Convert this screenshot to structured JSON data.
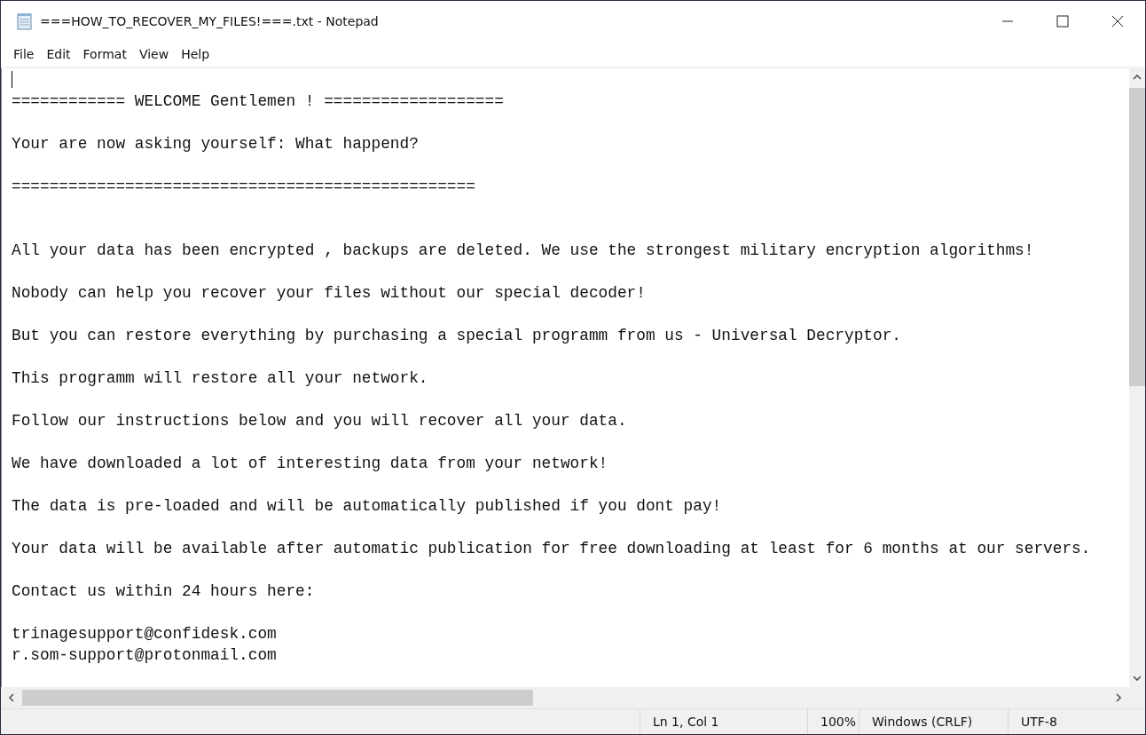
{
  "window": {
    "title": "===HOW_TO_RECOVER_MY_FILES!===.txt - Notepad"
  },
  "menu": [
    {
      "label": "File"
    },
    {
      "label": "Edit"
    },
    {
      "label": "Format"
    },
    {
      "label": "View"
    },
    {
      "label": "Help"
    }
  ],
  "editor": {
    "lines": [
      {
        "kind": "blank"
      },
      {
        "kind": "text",
        "text": "============ WELCOME Gentlemen ! ==================="
      },
      {
        "kind": "blank"
      },
      {
        "kind": "text",
        "text": "Your are now asking yourself: What happend?"
      },
      {
        "kind": "blank"
      },
      {
        "kind": "text",
        "text": "================================================="
      },
      {
        "kind": "blank"
      },
      {
        "kind": "blank"
      },
      {
        "kind": "text",
        "text": "All your data has been encrypted , backups are deleted. We use the strongest military encryption algorithms!"
      },
      {
        "kind": "blank"
      },
      {
        "kind": "text",
        "text": "Nobody can help you recover your files without our special decoder!"
      },
      {
        "kind": "blank"
      },
      {
        "kind": "text",
        "text": "But you can restore everything by purchasing a special programm from us - Universal Decryptor."
      },
      {
        "kind": "blank"
      },
      {
        "kind": "text",
        "text": "This programm will restore all your network."
      },
      {
        "kind": "blank"
      },
      {
        "kind": "text",
        "text": "Follow our instructions below and you will recover all your data."
      },
      {
        "kind": "blank"
      },
      {
        "kind": "text",
        "text": "We have downloaded a lot of interesting data from your network!"
      },
      {
        "kind": "blank"
      },
      {
        "kind": "text",
        "text": "The data is pre-loaded and will be automatically published if you dont pay!"
      },
      {
        "kind": "blank"
      },
      {
        "kind": "text",
        "text": "Your data will be available after automatic publication for free downloading at least for 6 months at our servers."
      },
      {
        "kind": "blank"
      },
      {
        "kind": "text",
        "text": "Contact us within 24 hours here:"
      },
      {
        "kind": "blank"
      },
      {
        "kind": "text",
        "text": "trinagesupport@confidesk.com"
      },
      {
        "kind": "text",
        "text": "r.som-support@protonmail.com"
      }
    ]
  },
  "status_bar": {
    "position": "Ln 1, Col 1",
    "zoom": "100%",
    "line_ending": "Windows (CRLF)",
    "encoding": "UTF-8"
  }
}
